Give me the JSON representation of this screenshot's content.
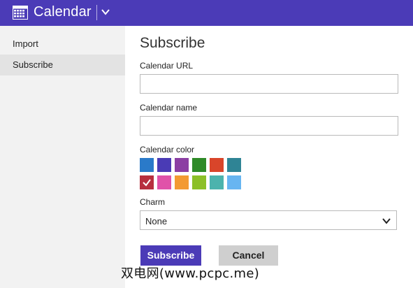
{
  "app": {
    "title": "Calendar"
  },
  "sidebar": {
    "items": [
      {
        "label": "Import",
        "selected": false
      },
      {
        "label": "Subscribe",
        "selected": true
      }
    ]
  },
  "form": {
    "heading": "Subscribe",
    "url_label": "Calendar URL",
    "url_value": "",
    "name_label": "Calendar name",
    "name_value": "",
    "color_label": "Calendar color",
    "colors": [
      "#2a7ac9",
      "#4a3bb5",
      "#8c3fa3",
      "#2f8a28",
      "#d9452a",
      "#2f8495",
      "#b72f3f",
      "#e052a9",
      "#f39a32",
      "#8cc028",
      "#4cb3ad",
      "#67b5f1"
    ],
    "selected_color": "#b72f3f",
    "charm_label": "Charm",
    "charm_value": "None",
    "subscribe_button": "Subscribe",
    "cancel_button": "Cancel"
  },
  "theme": {
    "accent": "#4b3bb7"
  },
  "watermark": "双电网(www.pcpc.me)"
}
